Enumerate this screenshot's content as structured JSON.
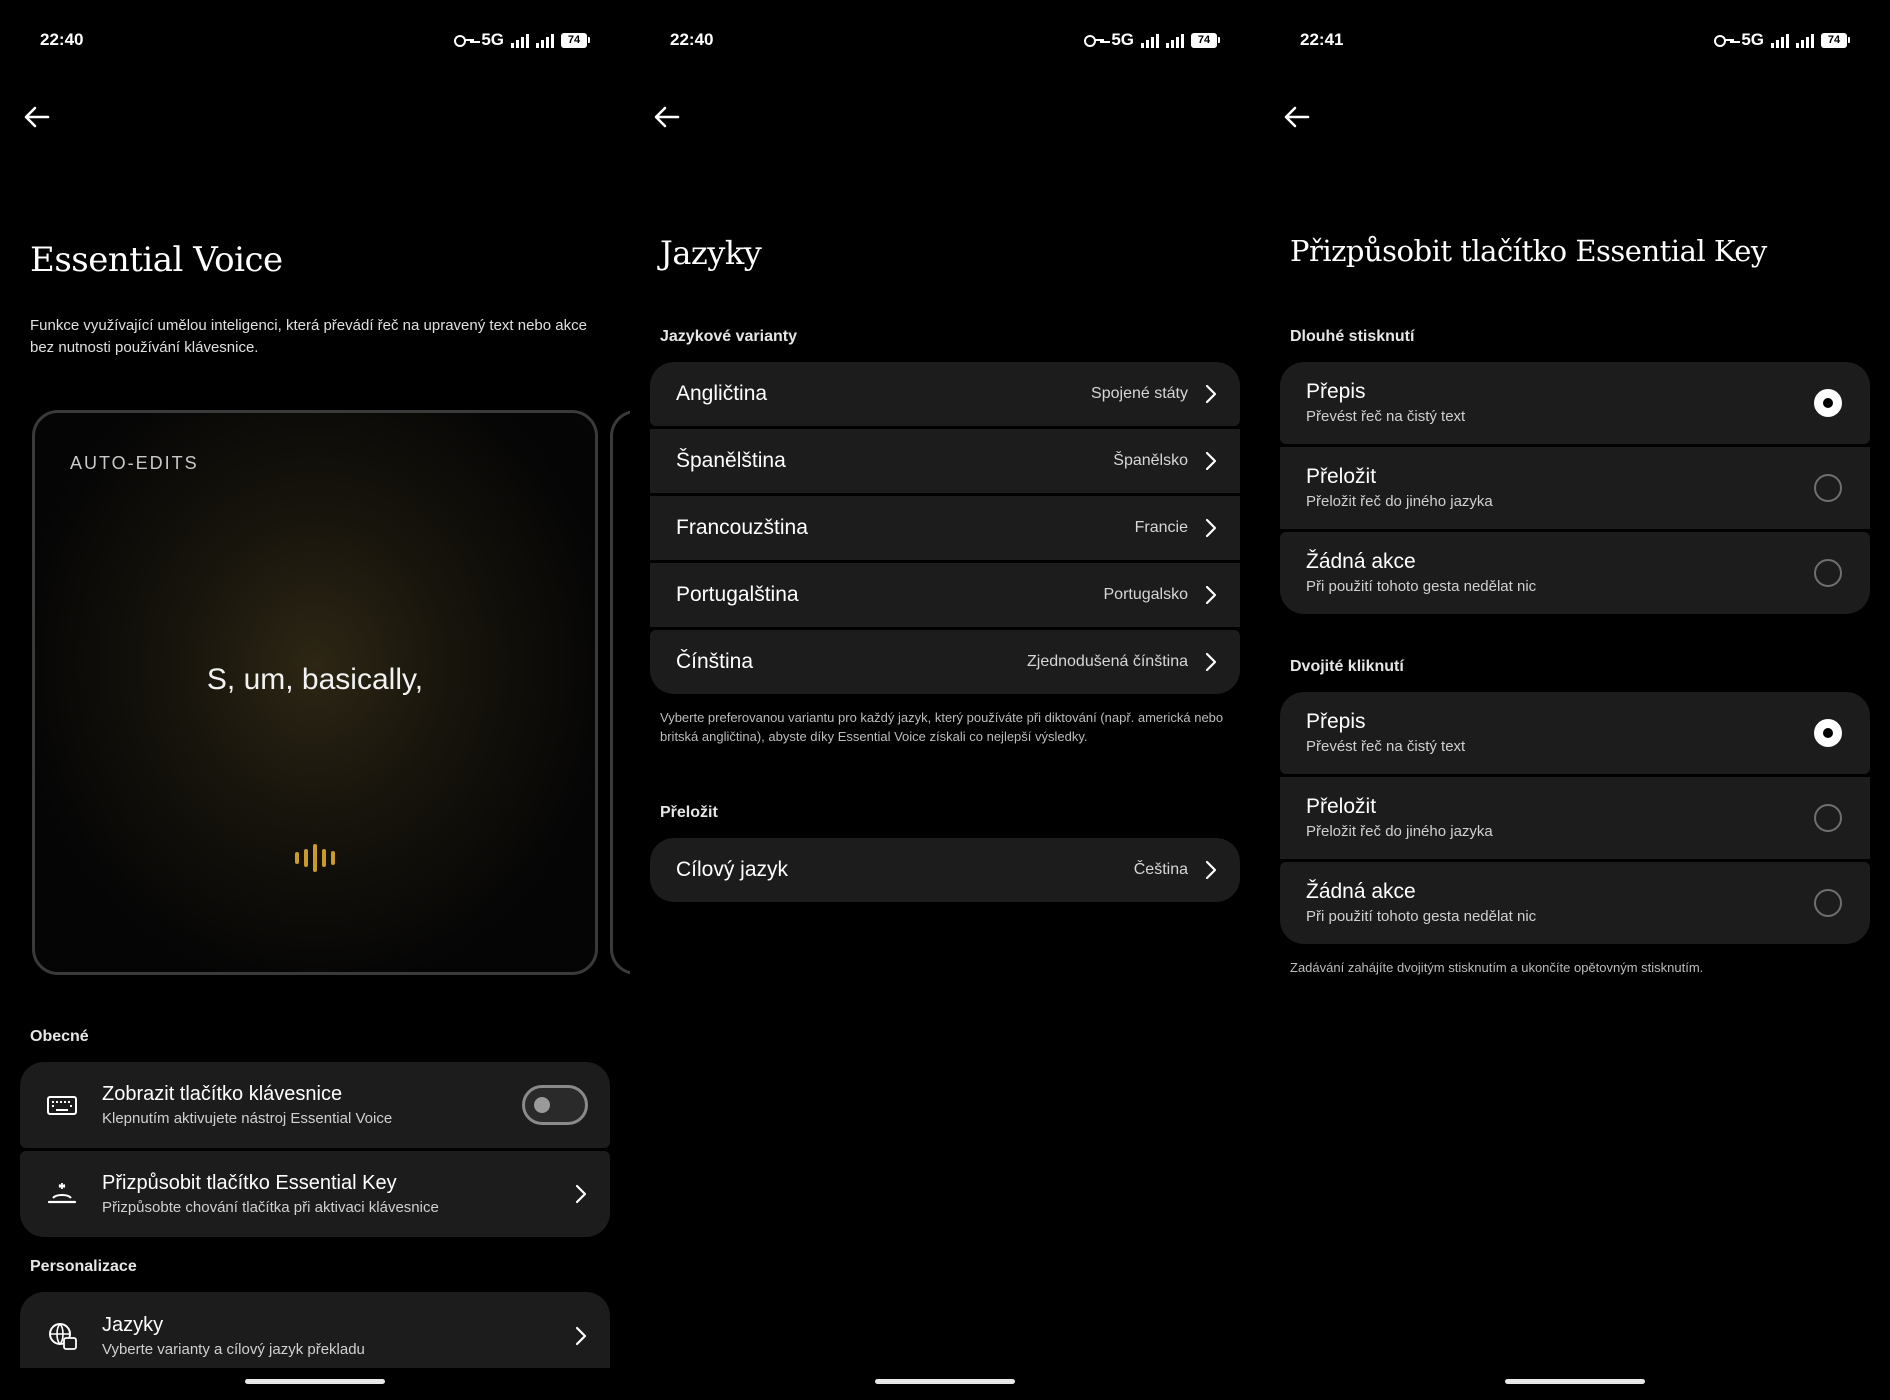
{
  "screens": {
    "voice": {
      "time": "22:40",
      "network": "5G",
      "battery": "74",
      "title": "Essential Voice",
      "description": "Funkce využívající umělou inteligenci, která převádí řeč na upravený text nebo akce bez nutnosti používání klávesnice.",
      "hero": {
        "label": "AUTO-EDITS",
        "text": "S, um, basically,"
      },
      "section_general": "Obecné",
      "keyboard_button": {
        "title": "Zobrazit tlačítko klávesnice",
        "subtitle": "Klepnutím aktivujete nástroj Essential Voice",
        "enabled": false
      },
      "essential_key": {
        "title": "Přizpůsobit tlačítko Essential Key",
        "subtitle": "Přizpůsobte chování tlačítka při aktivaci klávesnice"
      },
      "section_personalization": "Personalizace",
      "languages": {
        "title": "Jazyky",
        "subtitle": "Vyberte varianty a cílový jazyk překladu"
      }
    },
    "languages": {
      "time": "22:40",
      "network": "5G",
      "battery": "74",
      "title": "Jazyky",
      "section_variants": "Jazykové varianty",
      "variants": [
        {
          "name": "Angličtina",
          "value": "Spojené státy"
        },
        {
          "name": "Španělština",
          "value": "Španělsko"
        },
        {
          "name": "Francouzština",
          "value": "Francie"
        },
        {
          "name": "Portugalština",
          "value": "Portugalsko"
        },
        {
          "name": "Čínština",
          "value": "Zjednodušená čínština"
        }
      ],
      "variants_note": "Vyberte preferovanou variantu pro každý jazyk, který používáte při diktování (např. americká nebo britská angličtina), abyste díky Essential Voice získali co nejlepší výsledky.",
      "section_translate": "Přeložit",
      "target": {
        "name": "Cílový jazyk",
        "value": "Čeština"
      }
    },
    "key": {
      "time": "22:41",
      "network": "5G",
      "battery": "74",
      "title": "Přizpůsobit tlačítko Essential Key",
      "section_long": "Dlouhé stisknutí",
      "long_options": [
        {
          "title": "Přepis",
          "subtitle": "Převést řeč na čistý text",
          "selected": true
        },
        {
          "title": "Přeložit",
          "subtitle": "Přeložit řeč do jiného jazyka",
          "selected": false
        },
        {
          "title": "Žádná akce",
          "subtitle": "Při použití tohoto gesta nedělat nic",
          "selected": false
        }
      ],
      "section_double": "Dvojité kliknutí",
      "double_options": [
        {
          "title": "Přepis",
          "subtitle": "Převést řeč na čistý text",
          "selected": true
        },
        {
          "title": "Přeložit",
          "subtitle": "Přeložit řeč do jiného jazyka",
          "selected": false
        },
        {
          "title": "Žádná akce",
          "subtitle": "Při použití tohoto gesta nedělat nic",
          "selected": false
        }
      ],
      "double_note": "Zadávání zahájíte dvojitým stisknutím a ukončíte opětovným stisknutím."
    }
  },
  "colors": {
    "background": "#000000",
    "card": "#1c1c1c",
    "accent_wave": "#c89b2a"
  },
  "icons": {
    "back": "arrow-left-icon",
    "chevron": "chevron-right-icon",
    "keyboard": "keyboard-icon",
    "key": "essential-key-icon",
    "languages": "translate-globe-icon"
  }
}
